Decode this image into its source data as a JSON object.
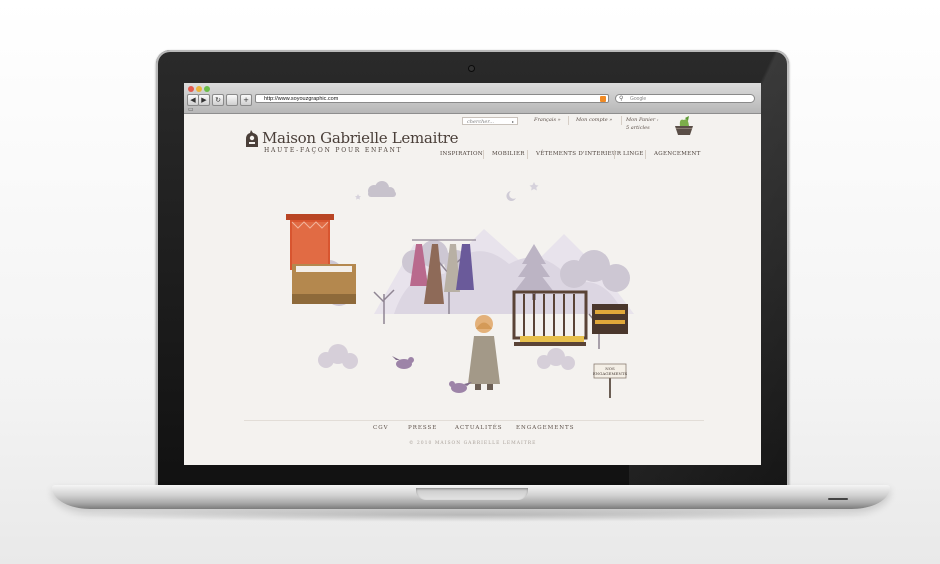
{
  "browser": {
    "url": "http://www.soyouzgraphic.com",
    "search_placeholder": "Google",
    "nav": {
      "back": "◀",
      "forward": "▶",
      "reload": "↻",
      "add": "+"
    }
  },
  "site": {
    "brand": "Maison Gabrielle Lemaitre",
    "tagline": "HAUTE-FAÇON POUR ENFANT",
    "search_placeholder": "chercher...",
    "language": "Français »",
    "account": "Mon compte »",
    "cart_label": "Mon Panier :",
    "cart_count": "5 articles",
    "menu": [
      "INSPIRATION",
      "MOBILIER",
      "VÊTEMENTS D'INTERIEUR",
      "LINGE",
      "AGENCEMENT"
    ],
    "hero_badge": [
      "NOS",
      "ENGAGEMENTS"
    ],
    "footer": {
      "links": [
        "CGV",
        "PRESSE",
        "ACTUALITÉS",
        "ENGAGEMENTS"
      ],
      "copyright": "© 2010 MAISON GABRIELLE LEMAITRE"
    }
  },
  "colors": {
    "brand_text": "#4a3f39",
    "page_bg": "#f4f2ef",
    "accent_red": "#d8552f",
    "accent_purple": "#8b6a9f"
  }
}
